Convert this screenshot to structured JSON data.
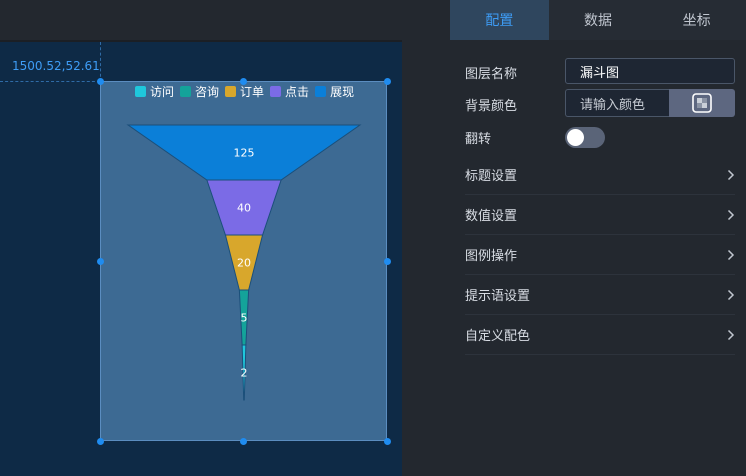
{
  "canvas": {
    "coordinate_readout": "1500.52,52.61"
  },
  "chart_data": {
    "type": "funnel",
    "categories": [
      "展现",
      "点击",
      "订单",
      "咨询",
      "访问"
    ],
    "values": [
      125,
      40,
      20,
      5,
      2
    ],
    "legend": [
      "访问",
      "咨询",
      "订单",
      "点击",
      "展现"
    ],
    "legend_placement": "top-center",
    "colors": {
      "访问": "#1fc7dc",
      "咨询": "#14a39a",
      "订单": "#d8a72c",
      "点击": "#7b6be6",
      "展现": "#0b7fd8"
    }
  },
  "panel": {
    "tabs": [
      {
        "label": "配置",
        "active": true
      },
      {
        "label": "数据",
        "active": false
      },
      {
        "label": "坐标",
        "active": false
      }
    ],
    "layer_name_label": "图层名称",
    "layer_name_value": "漏斗图",
    "bg_color_label": "背景颜色",
    "bg_color_placeholder": "请输入颜色",
    "flip_label": "翻转",
    "flip_on": false,
    "sections": [
      {
        "label": "标题设置"
      },
      {
        "label": "数值设置"
      },
      {
        "label": "图例操作"
      },
      {
        "label": "提示语设置"
      },
      {
        "label": "自定义配色"
      }
    ]
  },
  "icons": {
    "color_picker": "color-picker-icon",
    "chevron": "chevron-right-icon"
  }
}
